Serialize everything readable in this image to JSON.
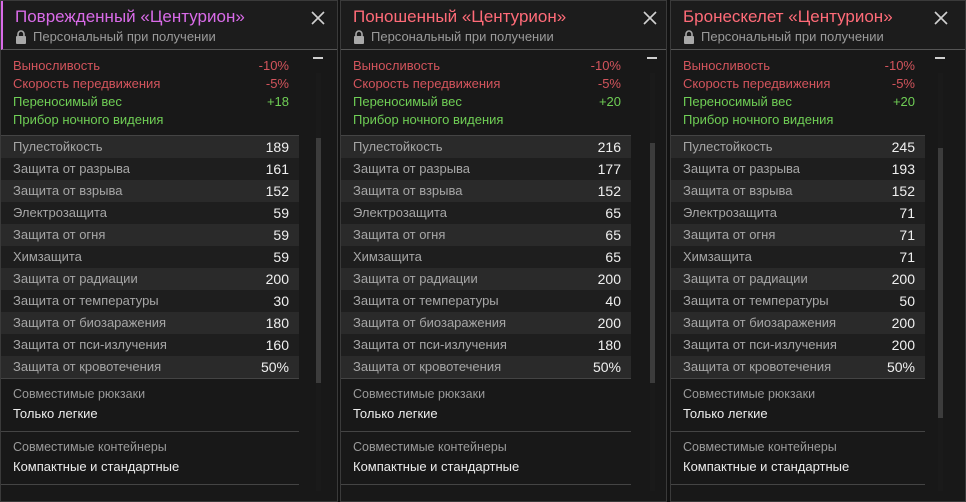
{
  "colors": {
    "title_purple": "#d96be8",
    "title_red": "#ff6b78",
    "negative": "#d2545c",
    "positive": "#6fce55"
  },
  "panels": [
    {
      "title": "Поврежденный «Центурион»",
      "title_color": "#d96be8",
      "subtitle": "Персональный при получении",
      "effects": [
        {
          "label": "Выносливость",
          "value": "-10%",
          "kind": "neg"
        },
        {
          "label": "Скорость передвижения",
          "value": "-5%",
          "kind": "neg"
        },
        {
          "label": "Переносимый вес",
          "value": "+18",
          "kind": "pos"
        },
        {
          "label": "Прибор ночного видения",
          "value": "",
          "kind": "pos"
        }
      ],
      "stats": [
        {
          "label": "Пулестойкость",
          "value": "189"
        },
        {
          "label": "Защита от разрыва",
          "value": "161"
        },
        {
          "label": "Защита от взрыва",
          "value": "152"
        },
        {
          "label": "Электрозащита",
          "value": "59"
        },
        {
          "label": "Защита от огня",
          "value": "59"
        },
        {
          "label": "Химзащита",
          "value": "59"
        },
        {
          "label": "Защита от радиации",
          "value": "200"
        },
        {
          "label": "Защита от температуры",
          "value": "30"
        },
        {
          "label": "Защита от биозаражения",
          "value": "180"
        },
        {
          "label": "Защита от пси-излучения",
          "value": "160"
        },
        {
          "label": "Защита от кровотечения",
          "value": "50%"
        }
      ],
      "backpacks_label": "Совместимые рюкзаки",
      "backpacks_value": "Только легкие",
      "containers_label": "Совместимые контейнеры",
      "containers_value": "Компактные и стандартные",
      "scroll_position": 0.2
    },
    {
      "title": "Поношенный «Центурион»",
      "title_color": "#ff6b78",
      "subtitle": "Персональный при получении",
      "effects": [
        {
          "label": "Выносливость",
          "value": "-10%",
          "kind": "neg"
        },
        {
          "label": "Скорость передвижения",
          "value": "-5%",
          "kind": "neg"
        },
        {
          "label": "Переносимый вес",
          "value": "+20",
          "kind": "pos"
        },
        {
          "label": "Прибор ночного видения",
          "value": "",
          "kind": "pos"
        }
      ],
      "stats": [
        {
          "label": "Пулестойкость",
          "value": "216"
        },
        {
          "label": "Защита от разрыва",
          "value": "177"
        },
        {
          "label": "Защита от взрыва",
          "value": "152"
        },
        {
          "label": "Электрозащита",
          "value": "65"
        },
        {
          "label": "Защита от огня",
          "value": "65"
        },
        {
          "label": "Химзащита",
          "value": "65"
        },
        {
          "label": "Защита от радиации",
          "value": "200"
        },
        {
          "label": "Защита от температуры",
          "value": "40"
        },
        {
          "label": "Защита от биозаражения",
          "value": "200"
        },
        {
          "label": "Защита от пси-излучения",
          "value": "180"
        },
        {
          "label": "Защита от кровотечения",
          "value": "50%"
        }
      ],
      "backpacks_label": "Совместимые рюкзаки",
      "backpacks_value": "Только легкие",
      "containers_label": "Совместимые контейнеры",
      "containers_value": "Компактные и стандартные",
      "scroll_position": 0.2
    },
    {
      "title": "Бронескелет «Центурион»",
      "title_color": "#ff6b78",
      "subtitle": "Персональный при получении",
      "effects": [
        {
          "label": "Выносливость",
          "value": "-10%",
          "kind": "neg"
        },
        {
          "label": "Скорость передвижения",
          "value": "-5%",
          "kind": "neg"
        },
        {
          "label": "Переносимый вес",
          "value": "+20",
          "kind": "pos"
        },
        {
          "label": "Прибор ночного видения",
          "value": "",
          "kind": "pos"
        }
      ],
      "stats": [
        {
          "label": "Пулестойкость",
          "value": "245"
        },
        {
          "label": "Защита от разрыва",
          "value": "193"
        },
        {
          "label": "Защита от взрыва",
          "value": "152"
        },
        {
          "label": "Электрозащита",
          "value": "71"
        },
        {
          "label": "Защита от огня",
          "value": "71"
        },
        {
          "label": "Химзащита",
          "value": "71"
        },
        {
          "label": "Защита от радиации",
          "value": "200"
        },
        {
          "label": "Защита от температуры",
          "value": "50"
        },
        {
          "label": "Защита от биозаражения",
          "value": "200"
        },
        {
          "label": "Защита от пси-излучения",
          "value": "200"
        },
        {
          "label": "Защита от кровотечения",
          "value": "50%"
        }
      ],
      "backpacks_label": "Совместимые рюкзаки",
      "backpacks_value": "Только легкие",
      "containers_label": "Совместимые контейнеры",
      "containers_value": "Компактные и стандартные",
      "scroll_position": 0.2
    }
  ]
}
